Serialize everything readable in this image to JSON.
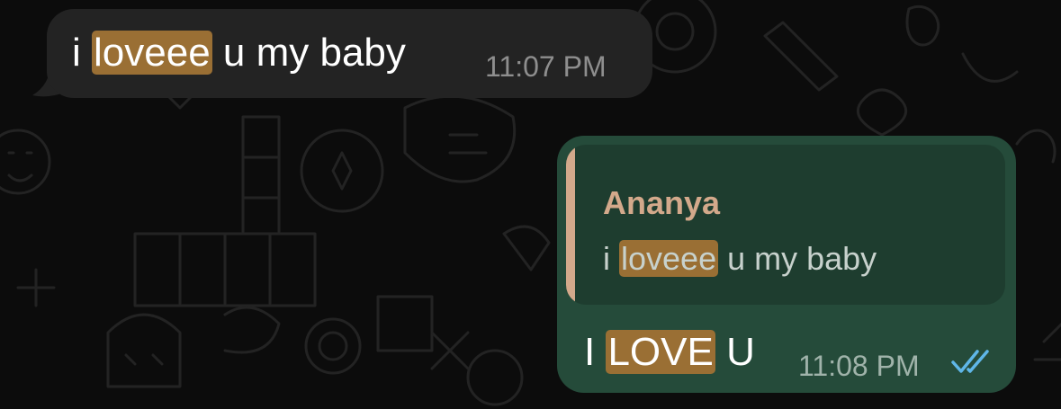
{
  "incoming": {
    "pre": "i ",
    "highlight": "loveee",
    "post": " u my baby",
    "time": "11:07 PM"
  },
  "outgoing": {
    "quote": {
      "author": "Ananya",
      "pre": "i ",
      "highlight": "loveee",
      "post": " u my baby"
    },
    "pre": "I ",
    "highlight": "LOVE",
    "post": " U",
    "time": "11:08 PM",
    "status_icon": "double-check-read-icon"
  },
  "colors": {
    "incoming_bubble": "#232323",
    "outgoing_bubble": "#254b3a",
    "highlight": "#9a6f34",
    "quote_accent": "#d3a98b",
    "read_ticks": "#5fb6e8"
  }
}
